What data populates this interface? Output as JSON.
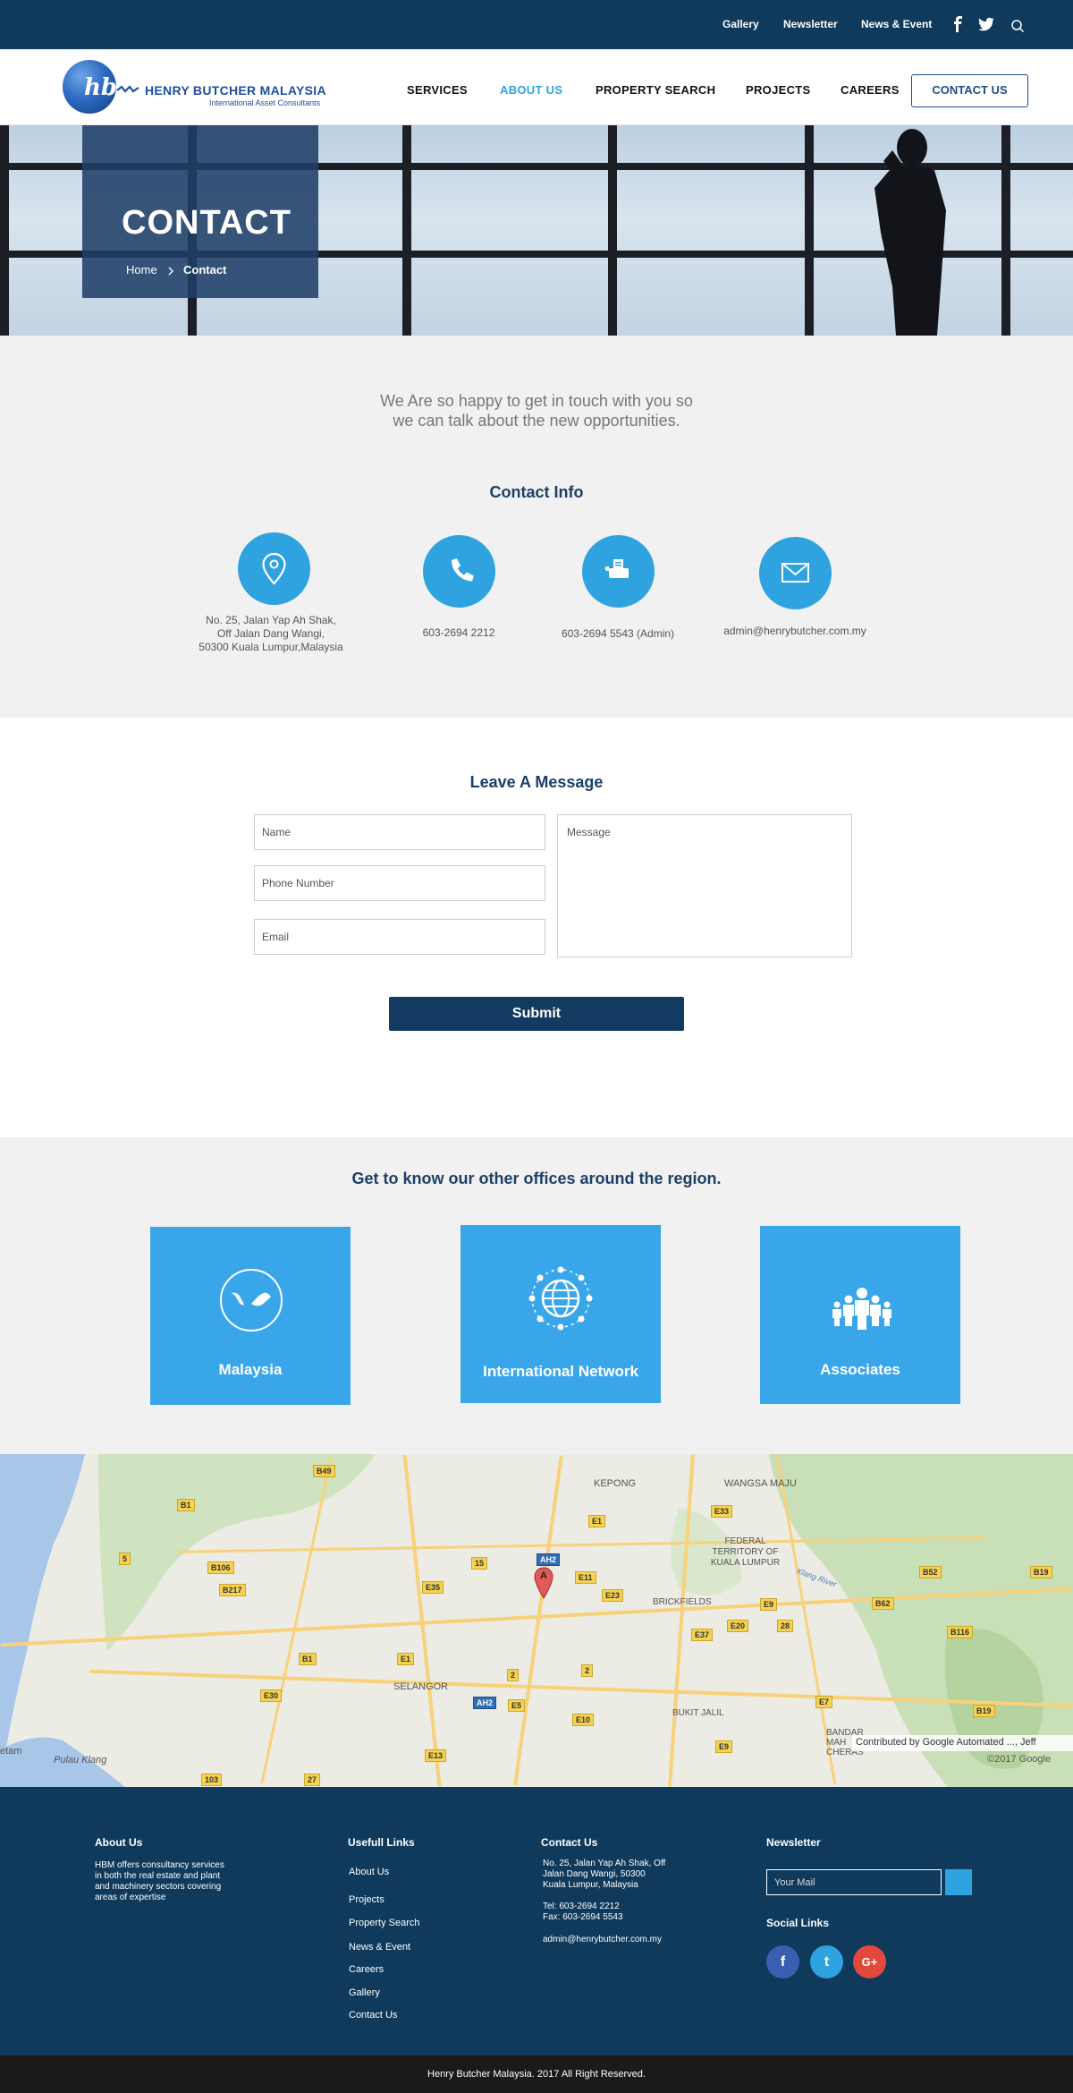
{
  "topbar": {
    "links": [
      "Gallery",
      "Newsletter",
      "News & Event"
    ],
    "icons": [
      "facebook-icon",
      "twitter-icon",
      "search-icon"
    ]
  },
  "brand": {
    "mark": "hb",
    "name": "HENRY BUTCHER MALAYSIA",
    "tagline": "International Asset Consultants"
  },
  "nav": {
    "items": [
      "SERVICES",
      "ABOUT US",
      "PROPERTY SEARCH",
      "PROJECTS",
      "CAREERS"
    ],
    "active": "ABOUT US",
    "cta": "CONTACT US"
  },
  "hero": {
    "title": "CONTACT",
    "breadcrumb": [
      "Home",
      "Contact"
    ]
  },
  "intro": {
    "line1": "We Are so happy to get in touch with you so",
    "line2": "we can talk about the new opportunities."
  },
  "contact_info": {
    "title": "Contact Info",
    "address": [
      "No. 25, Jalan Yap Ah Shak,",
      "Off Jalan Dang Wangi,",
      "50300 Kuala Lumpur,Malaysia"
    ],
    "phone": "603-2694 2212",
    "fax": "603-2694 5543 (Admin)",
    "email": "admin@henrybutcher.com.my"
  },
  "form": {
    "title": "Leave A Message",
    "name_placeholder": "Name",
    "phone_placeholder": "Phone Number",
    "email_placeholder": "Email",
    "message_placeholder": "Message",
    "submit": "Submit"
  },
  "offices": {
    "title": "Get to know our other offices around the region.",
    "items": [
      "Malaysia",
      "International Network",
      "Associates"
    ]
  },
  "map": {
    "labels": [
      "KEPONG",
      "WANGSA MAJU",
      "FEDERAL TERRITORY OF KUALA LUMPUR",
      "BRICKFIELDS",
      "SELANGOR",
      "BUKIT JALIL",
      "Pulau Klang",
      "Klang River",
      "BANDAR MAH CHERAS",
      "etam"
    ],
    "marker": "A",
    "attribution": "Contributed by Google Automated ..., Jeff",
    "copyright": "©2017 Google",
    "shields": [
      "B49",
      "B1",
      "5",
      "B106",
      "B217",
      "15",
      "E35",
      "AH2",
      "E1",
      "E11",
      "E23",
      "E33",
      "E37",
      "E9",
      "E20",
      "28",
      "B52",
      "B19",
      "B62",
      "B116",
      "E1",
      "B1",
      "E30",
      "AH2",
      "E5",
      "2",
      "2",
      "E10",
      "E13",
      "E9",
      "B19",
      "E7",
      "103",
      "27"
    ]
  },
  "footer": {
    "about_title": "About Us",
    "about_text": [
      "HBM offers consultancy services",
      "in both the real estate and plant",
      "and machinery sectors covering",
      "areas of expertise"
    ],
    "links_title": "Usefull Links",
    "links": [
      "About Us",
      "Projects",
      "Property Search",
      "News & Event",
      "Careers",
      "Gallery",
      "Contact Us"
    ],
    "contact_title": "Contact Us",
    "contact_lines": [
      "No. 25, Jalan Yap Ah Shak, Off",
      "Jalan Dang Wangi, 50300",
      "Kuala Lumpur, Malaysia"
    ],
    "tel": "Tel: 603-2694 2212",
    "fax": "Fax: 603-2694 5543",
    "email": "admin@henrybutcher.com.my",
    "newsletter_title": "Newsletter",
    "newsletter_placeholder": "Your Mail",
    "social_title": "Social Links",
    "social": [
      "f",
      "t",
      "G+"
    ],
    "copyright": "Henry Butcher Malaysia. 2017 All Right Reserved."
  },
  "colors": {
    "navy": "#0f3a5c",
    "accent": "#2ea3e0",
    "office_tile": "#3aa6ea",
    "bottom_bar": "#1a1a1a"
  }
}
